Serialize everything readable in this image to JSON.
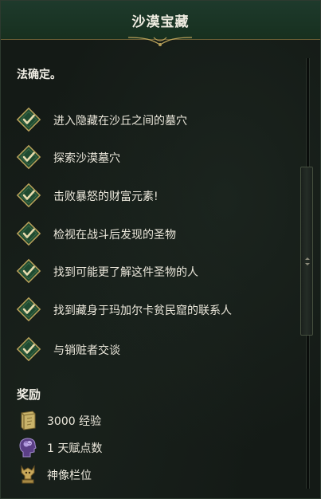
{
  "window": {
    "title": "沙漠宝藏"
  },
  "intro_text": "法确定。",
  "objectives": [
    {
      "label": "进入隐藏在沙丘之间的墓穴",
      "completed": true
    },
    {
      "label": "探索沙漠墓穴",
      "completed": true
    },
    {
      "label": "击败暴怒的财富元素!",
      "completed": true
    },
    {
      "label": "检视在战斗后发现的圣物",
      "completed": true
    },
    {
      "label": "找到可能更了解这件圣物的人",
      "completed": true
    },
    {
      "label": "找到藏身于玛加尔卡贫民窟的联系人",
      "completed": true
    },
    {
      "label": "与销赃者交谈",
      "completed": true
    }
  ],
  "rewards": {
    "title": "奖励",
    "items": [
      {
        "icon": "tome-icon",
        "amount": "3000",
        "label": "经验"
      },
      {
        "icon": "brain-talent-icon",
        "amount": "1",
        "label": "天赋点数"
      },
      {
        "icon": "idol-icon",
        "amount": "",
        "label": "神像栏位"
      }
    ]
  },
  "colors": {
    "header": "#1e3a2c",
    "checkbox_fill": "#1f4a30",
    "checkbox_border": "#b8a15a",
    "check": "#e7dcae",
    "gold": "#b8a15a"
  }
}
